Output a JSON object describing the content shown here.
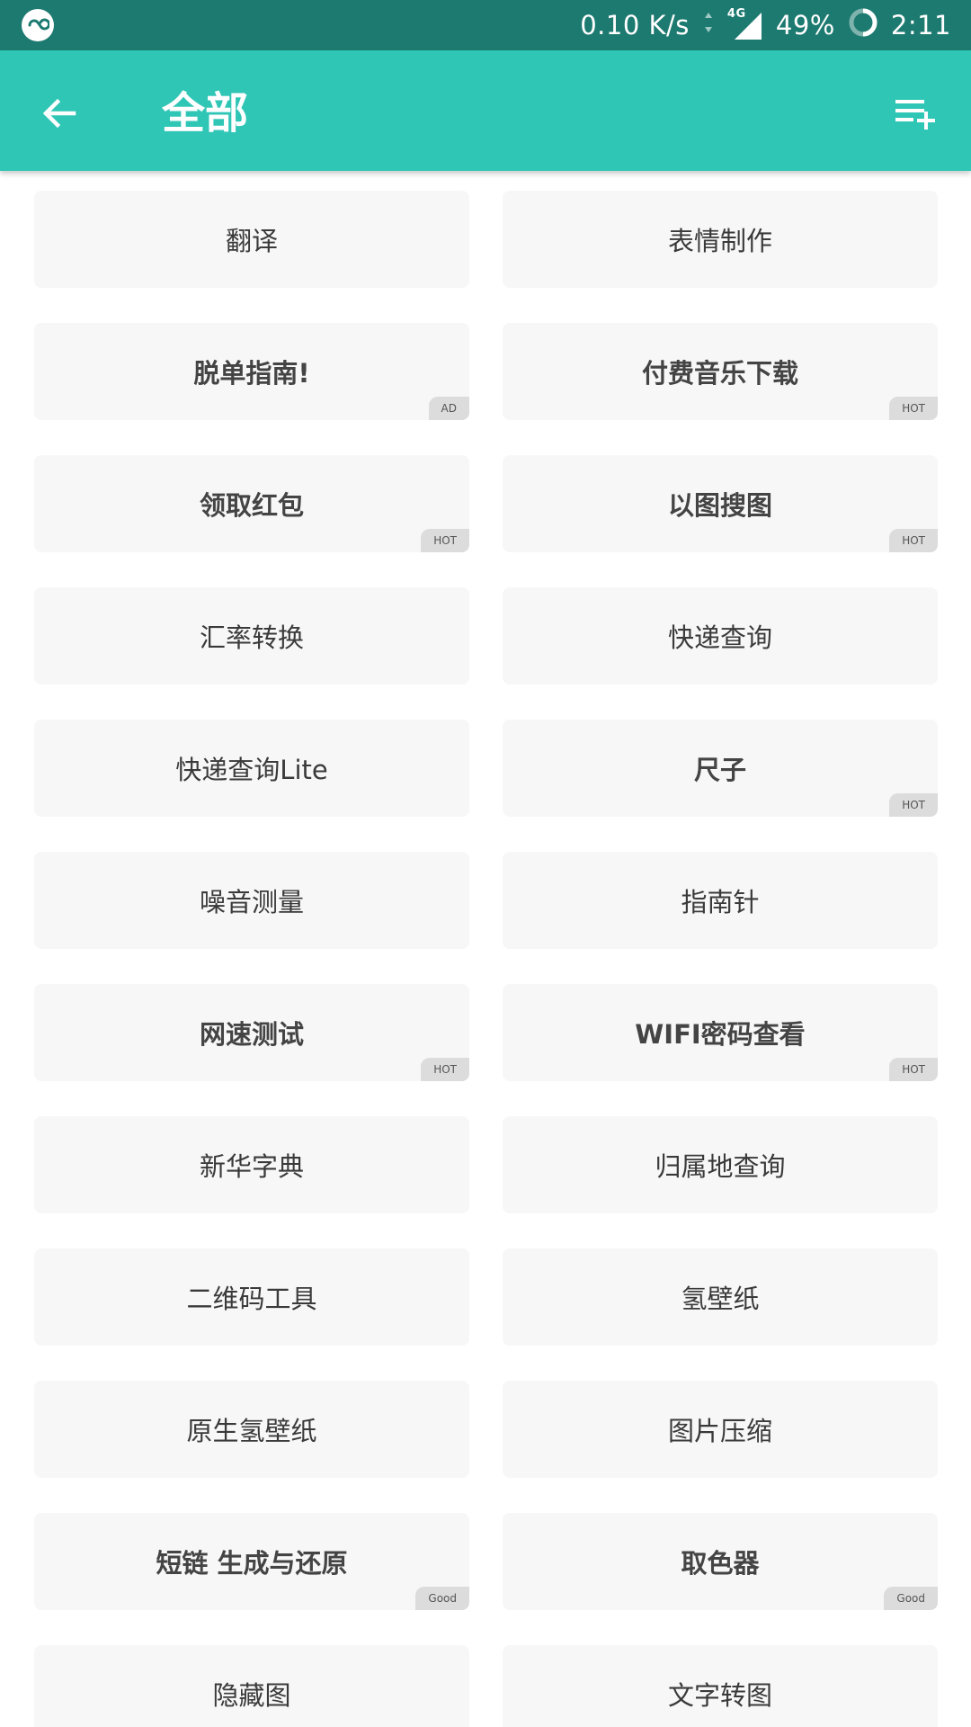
{
  "status_bar": {
    "logo_icon": "app-logo-icon",
    "net_speed": "0.10 K/s",
    "network": "4G",
    "battery": "49%",
    "time": "2:11"
  },
  "app_bar": {
    "title": "全部",
    "back_icon": "arrow-left-icon",
    "add_icon": "playlist-add-icon",
    "color": "#30c6b6"
  },
  "tools": [
    {
      "label": "翻译",
      "bold": false,
      "badge": ""
    },
    {
      "label": "表情制作",
      "bold": false,
      "badge": ""
    },
    {
      "label": "脱单指南!",
      "bold": true,
      "badge": "AD"
    },
    {
      "label": "付费音乐下载",
      "bold": true,
      "badge": "HOT"
    },
    {
      "label": "领取红包",
      "bold": true,
      "badge": "HOT"
    },
    {
      "label": "以图搜图",
      "bold": true,
      "badge": "HOT"
    },
    {
      "label": "汇率转换",
      "bold": false,
      "badge": ""
    },
    {
      "label": "快递查询",
      "bold": false,
      "badge": ""
    },
    {
      "label": "快递查询Lite",
      "bold": false,
      "badge": ""
    },
    {
      "label": "尺子",
      "bold": true,
      "badge": "HOT"
    },
    {
      "label": "噪音测量",
      "bold": false,
      "badge": ""
    },
    {
      "label": "指南针",
      "bold": false,
      "badge": ""
    },
    {
      "label": "网速测试",
      "bold": true,
      "badge": "HOT"
    },
    {
      "label": "WIFI密码查看",
      "bold": true,
      "badge": "HOT"
    },
    {
      "label": "新华字典",
      "bold": false,
      "badge": ""
    },
    {
      "label": "归属地查询",
      "bold": false,
      "badge": ""
    },
    {
      "label": "二维码工具",
      "bold": false,
      "badge": ""
    },
    {
      "label": "氢壁纸",
      "bold": false,
      "badge": ""
    },
    {
      "label": "原生氢壁纸",
      "bold": false,
      "badge": ""
    },
    {
      "label": "图片压缩",
      "bold": false,
      "badge": ""
    },
    {
      "label": "短链 生成与还原",
      "bold": true,
      "badge": "Good"
    },
    {
      "label": "取色器",
      "bold": true,
      "badge": "Good"
    },
    {
      "label": "隐藏图",
      "bold": false,
      "badge": ""
    },
    {
      "label": "文字转图",
      "bold": false,
      "badge": ""
    }
  ]
}
